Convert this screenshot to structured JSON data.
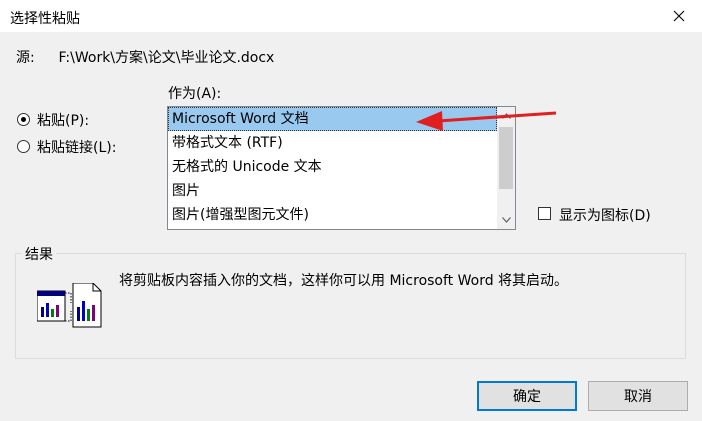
{
  "window": {
    "title": "选择性粘贴"
  },
  "source": {
    "label": "源:",
    "path": "F:\\Work\\方案\\论文\\毕业论文.docx"
  },
  "options": {
    "paste_label": "粘贴(P):",
    "paste_link_label": "粘贴链接(L):",
    "selected": "paste"
  },
  "as": {
    "label": "作为(A):",
    "items": [
      "Microsoft Word 文档",
      "带格式文本 (RTF)",
      "无格式的 Unicode 文本",
      "图片",
      "图片(增强型图元文件)"
    ],
    "selected_index": 0
  },
  "display_as_icon": {
    "label": "显示为图标(D)",
    "checked": false
  },
  "result": {
    "group_label": "结果",
    "text": "将剪贴板内容插入你的文档，这样你可以用 Microsoft Word 将其启动。"
  },
  "buttons": {
    "ok": "确定",
    "cancel": "取消"
  },
  "colors": {
    "selection": "#99c9ef",
    "annotation_arrow": "#e02020"
  },
  "icons": {
    "close": "close-icon",
    "result": "embedded-document-icon"
  }
}
